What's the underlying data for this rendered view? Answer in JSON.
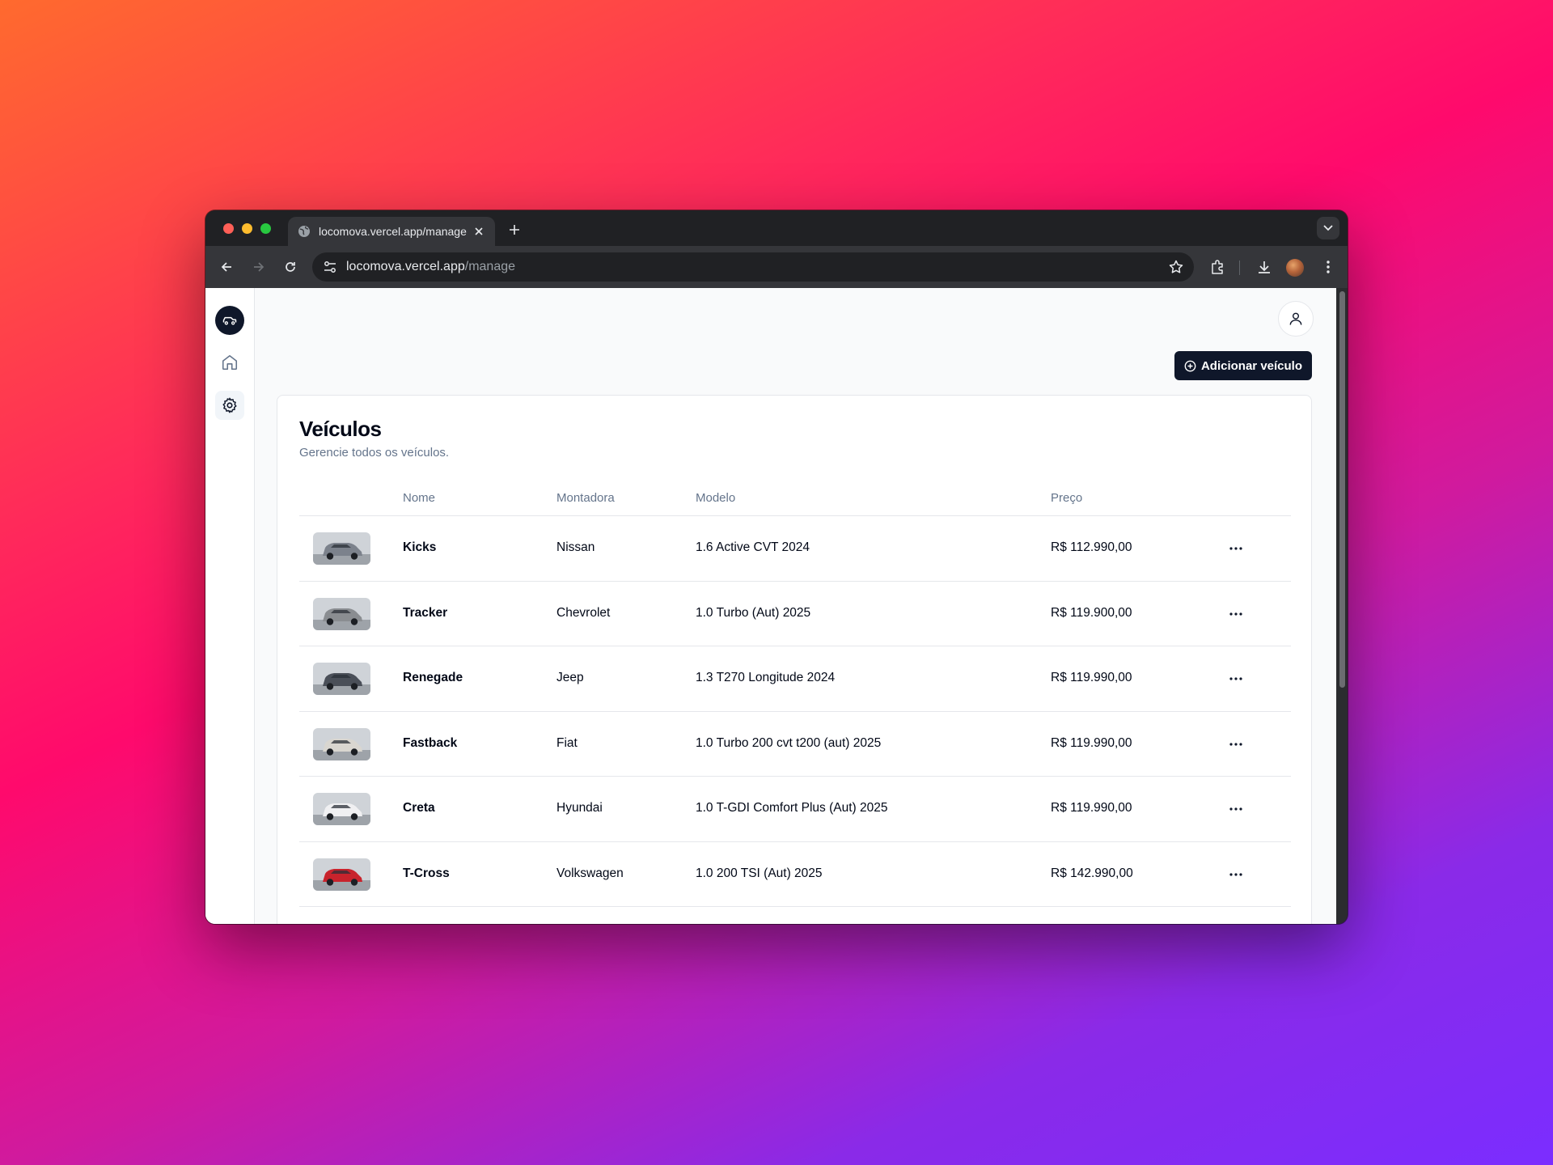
{
  "browser": {
    "tab_title": "locomova.vercel.app/manage",
    "url_host": "locomova.vercel.app",
    "url_path": "/manage",
    "traffic_lights": [
      "#ff5f57",
      "#febc2e",
      "#28c840"
    ]
  },
  "app": {
    "add_button_label": "Adicionar veículo",
    "card_title": "Veículos",
    "card_subtitle": "Gerencie todos os veículos.",
    "columns": {
      "name": "Nome",
      "maker": "Montadora",
      "model": "Modelo",
      "price": "Preço"
    },
    "rows": [
      {
        "name": "Kicks",
        "maker": "Nissan",
        "model": "1.6 Active CVT 2024",
        "price": "R$ 112.990,00",
        "car_color": "#7c828c"
      },
      {
        "name": "Tracker",
        "maker": "Chevrolet",
        "model": "1.0 Turbo (Aut) 2025",
        "price": "R$ 119.900,00",
        "car_color": "#8a8d91"
      },
      {
        "name": "Renegade",
        "maker": "Jeep",
        "model": "1.3 T270 Longitude 2024",
        "price": "R$ 119.990,00",
        "car_color": "#4a4f58"
      },
      {
        "name": "Fastback",
        "maker": "Fiat",
        "model": "1.0 Turbo 200 cvt t200 (aut) 2025",
        "price": "R$ 119.990,00",
        "car_color": "#d9d6d0"
      },
      {
        "name": "Creta",
        "maker": "Hyundai",
        "model": "1.0 T-GDI Comfort Plus (Aut) 2025",
        "price": "R$ 119.990,00",
        "car_color": "#f0f0f2"
      },
      {
        "name": "T-Cross",
        "maker": "Volkswagen",
        "model": "1.0 200 TSI (Aut) 2025",
        "price": "R$ 142.990,00",
        "car_color": "#c8232c"
      }
    ]
  },
  "colors": {
    "primary": "#0f172a",
    "muted_text": "#64748b",
    "border": "#e5e7eb"
  }
}
